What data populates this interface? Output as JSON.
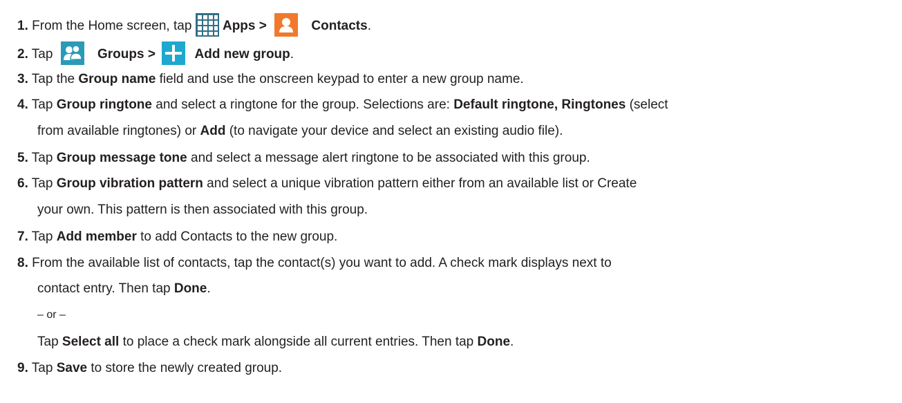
{
  "colors": {
    "apps_icon": "#2f6f86",
    "contacts_icon": "#f0792b",
    "groups_icon": "#2a9ab7",
    "add_icon": "#1ea8cf",
    "text": "#231f20"
  },
  "icons": {
    "apps": "grid-icon",
    "contacts": "person-icon",
    "groups": "people-icon",
    "add": "plus-icon"
  },
  "steps": {
    "s1": {
      "num": "1.",
      "pre": "From the Home screen, tap",
      "apps": "Apps >",
      "contacts": "Contacts",
      "end": "."
    },
    "s2": {
      "num": "2.",
      "pre": "Tap",
      "groups": "Groups >",
      "add": "Add new group",
      "end": "."
    },
    "s3": {
      "num": "3.",
      "pre": "Tap the ",
      "b1": "Group name",
      "post": " field and use the onscreen keypad to enter a new group name."
    },
    "s4": {
      "num": "4.",
      "pre": "Tap ",
      "b1": "Group ringtone",
      "mid": " and select a ringtone for the group. Selections are: ",
      "b2": "Default ringtone, Ringtones",
      "post": " (select",
      "line2_pre": "from available ringtones) or ",
      "line2_b": "Add",
      "line2_post": " (to navigate your device and select an existing audio file)."
    },
    "s5": {
      "num": "5.",
      "pre": "Tap ",
      "b1": "Group message tone",
      "post": " and select a message alert ringtone to be associated with this group."
    },
    "s6": {
      "num": "6.",
      "pre": "Tap ",
      "b1": "Group vibration pattern",
      "post": " and select a unique vibration pattern either from an available list or Create",
      "line2": "your own. This pattern is then associated with this group."
    },
    "s7": {
      "num": "7.",
      "pre": "Tap ",
      "b1": "Add member",
      "post": " to add Contacts to the new group."
    },
    "s8": {
      "num": "8.",
      "line1": "From the available list of contacts, tap the contact(s) you want to add. A check mark displays next to",
      "line2_pre": "contact entry. Then tap ",
      "line2_b": "Done",
      "line2_end": ".",
      "or": "– or –",
      "alt_pre": "Tap ",
      "alt_b1": "Select all",
      "alt_mid": " to place a check mark alongside all current entries. Then tap ",
      "alt_b2": "Done",
      "alt_end": "."
    },
    "s9": {
      "num": "9.",
      "pre": "Tap ",
      "b1": "Save",
      "post": " to store the newly created group."
    }
  }
}
